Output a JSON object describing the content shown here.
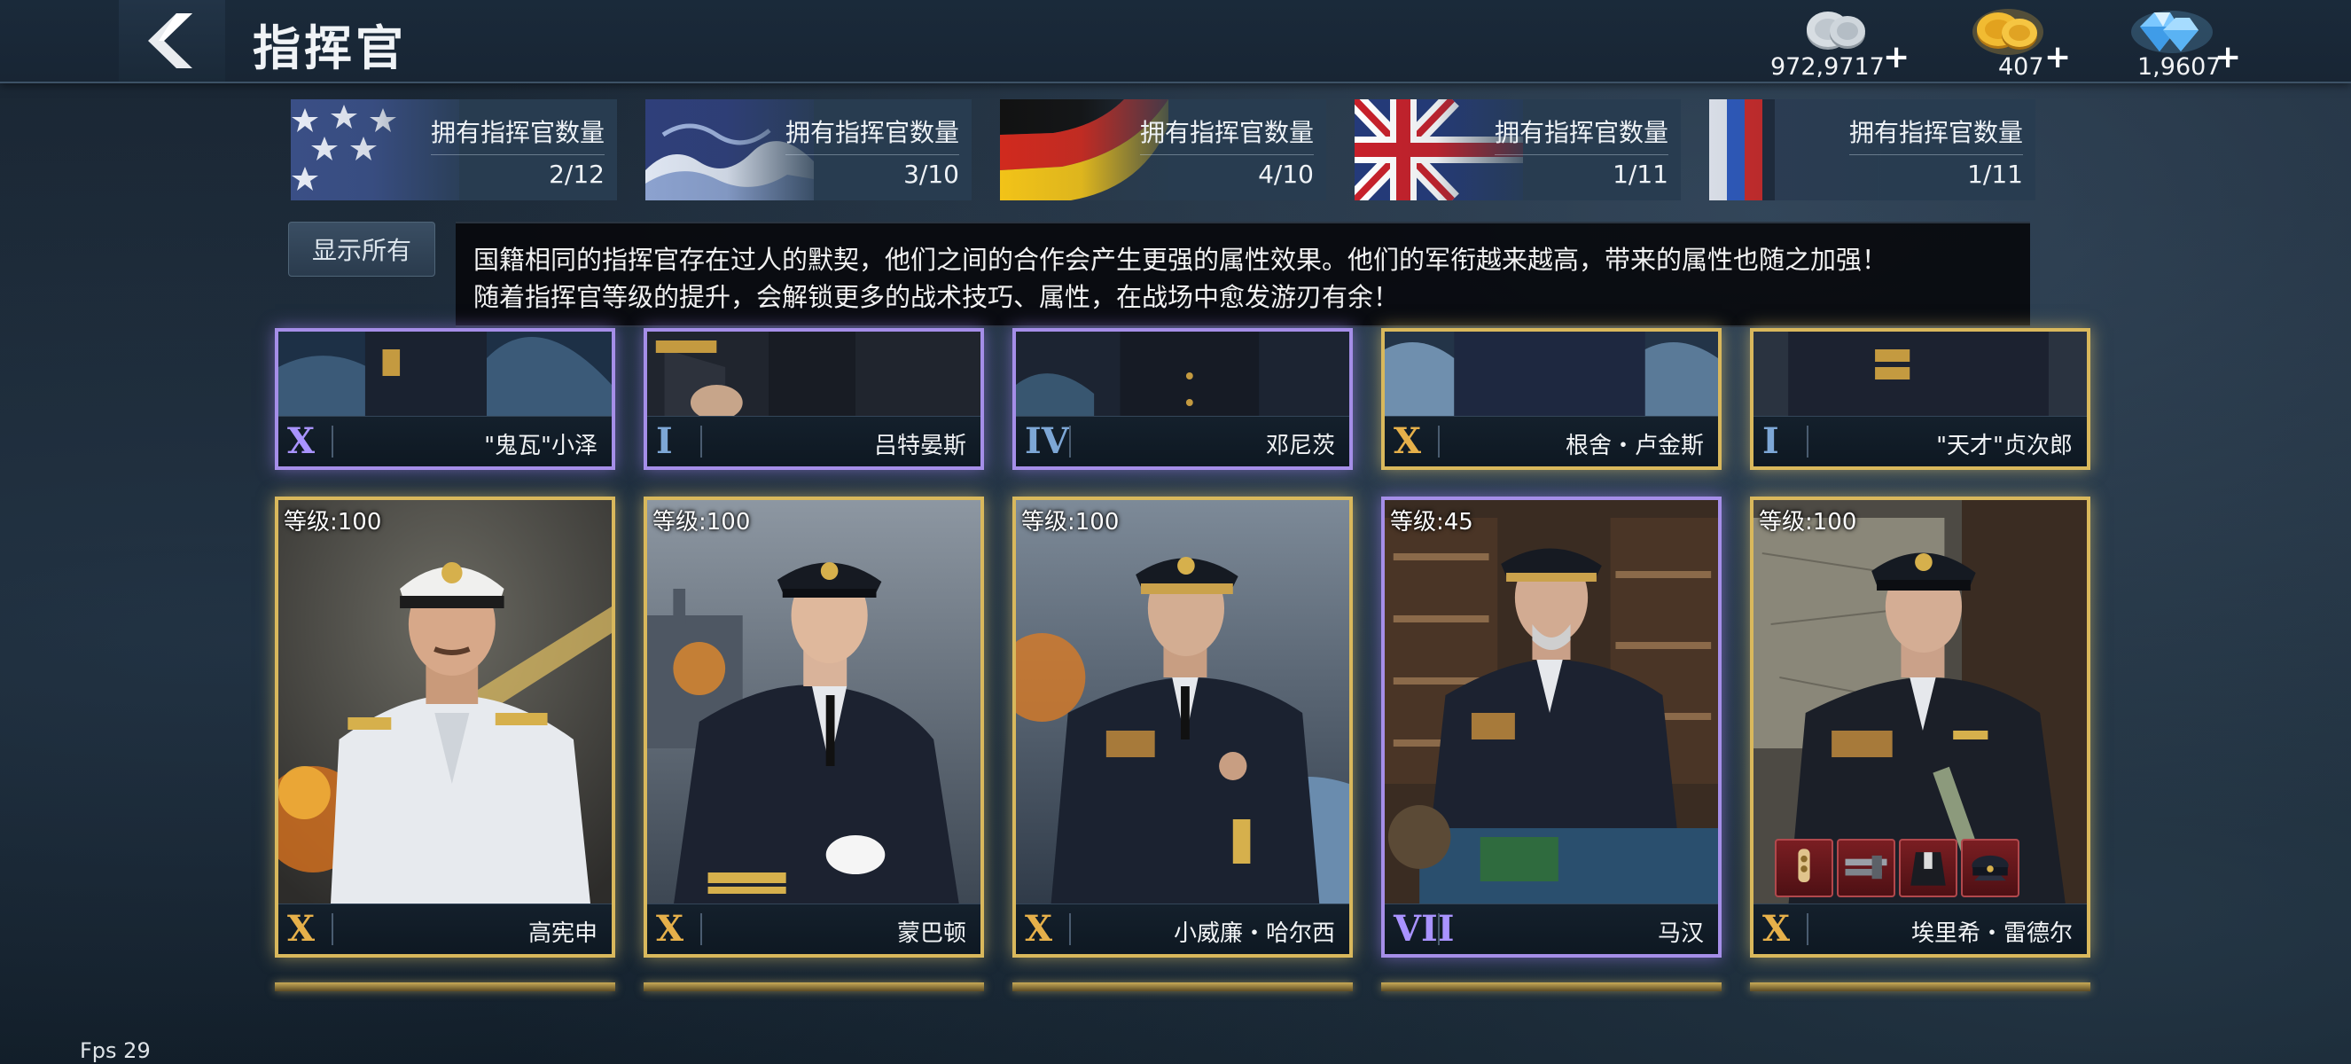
{
  "header": {
    "title": "指挥官",
    "back_icon": "back-arrow-icon"
  },
  "currencies": [
    {
      "name": "silver-coins-icon",
      "value": "972,9717",
      "plus": "+"
    },
    {
      "name": "gold-coins-icon",
      "value": "407",
      "plus": "+"
    },
    {
      "name": "diamonds-icon",
      "value": "1,9607",
      "plus": "+"
    }
  ],
  "nations": [
    {
      "flag": "usa-flag",
      "label": "拥有指挥官数量",
      "count": "2/12"
    },
    {
      "flag": "japan-flag",
      "label": "拥有指挥官数量",
      "count": "3/10"
    },
    {
      "flag": "germany-flag",
      "label": "拥有指挥官数量",
      "count": "4/10"
    },
    {
      "flag": "uk-flag",
      "label": "拥有指挥官数量",
      "count": "1/11"
    },
    {
      "flag": "ussr-flag",
      "label": "拥有指挥官数量",
      "count": "1/11"
    }
  ],
  "show_all": "显示所有",
  "info": {
    "line1": "国籍相同的指挥官存在过人的默契，他们之间的合作会产生更强的属性效果。他们的军衔越来越高，带来的属性也随之加强！",
    "line2": "随着指挥官等级的提升，会解锁更多的战术技巧、属性，在战场中愈发游刃有余！"
  },
  "row1": [
    {
      "rank": "X",
      "name": "\"鬼瓦\"小泽",
      "frame": "purple"
    },
    {
      "rank": "I",
      "name": "吕特晏斯",
      "frame": "purple"
    },
    {
      "rank": "IV",
      "name": "邓尼茨",
      "frame": "purple"
    },
    {
      "rank": "X",
      "name": "根舍・卢金斯",
      "frame": "gold"
    },
    {
      "rank": "I",
      "name": "\"天才\"贞次郎",
      "frame": "gold"
    }
  ],
  "row2": [
    {
      "level": "等级:100",
      "rank": "X",
      "name": "高宪申",
      "frame": "gold"
    },
    {
      "level": "等级:100",
      "rank": "X",
      "name": "蒙巴顿",
      "frame": "gold"
    },
    {
      "level": "等级:100",
      "rank": "X",
      "name": "小威廉・哈尔西",
      "frame": "gold"
    },
    {
      "level": "等级:45",
      "rank": "VII",
      "name": "马汉",
      "frame": "purple"
    },
    {
      "level": "等级:100",
      "rank": "X",
      "name": "埃里希・雷德尔",
      "frame": "gold"
    }
  ],
  "equipment": [
    "medal-icon",
    "guns-icon",
    "uniform-icon",
    "cap-icon"
  ],
  "fps": "Fps 29",
  "colors": {
    "gold_frame": "#d9b85c",
    "purple_frame": "#a58ee8",
    "rank_gold": "#e6b04a",
    "rank_purple": "#a993ff",
    "info_bg": "#08090e"
  }
}
